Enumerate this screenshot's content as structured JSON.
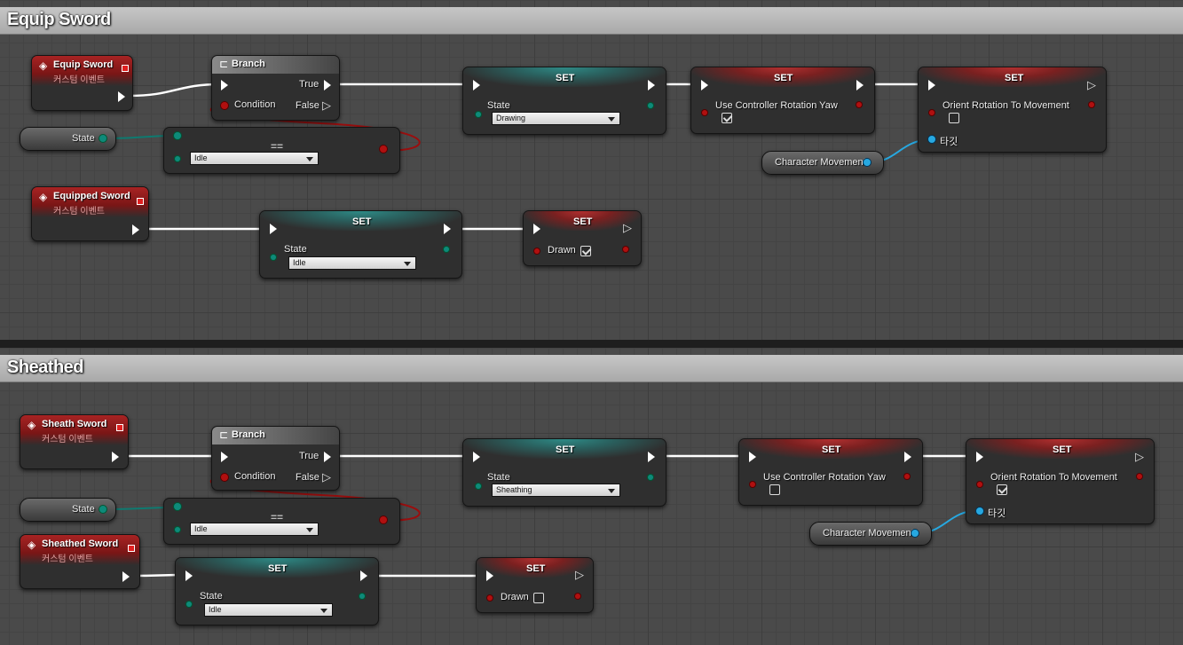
{
  "sections": [
    {
      "comment": "Equip Sword",
      "event": {
        "title": "Equip Sword",
        "subtitle": "커스텀 이벤트"
      },
      "branch": {
        "title": "Branch",
        "condition": "Condition",
        "true_label": "True",
        "false_label": "False"
      },
      "state_var": "State",
      "equals": {
        "symbol": "==",
        "value": "Idle"
      },
      "set_state": {
        "title": "SET",
        "pin_label": "State",
        "value": "Drawing"
      },
      "set_yaw": {
        "title": "SET",
        "pin_label": "Use Controller Rotation Yaw",
        "checked": true
      },
      "set_orient": {
        "title": "SET",
        "pin_label": "Orient Rotation To Movement",
        "target": "타깃",
        "checked": false
      },
      "char_movement": "Character Movement",
      "event2": {
        "title": "Equipped Sword",
        "subtitle": "커스텀 이벤트"
      },
      "set_state2": {
        "title": "SET",
        "pin_label": "State",
        "value": "Idle"
      },
      "set_drawn": {
        "title": "SET",
        "pin_label": "Drawn",
        "checked": true
      }
    },
    {
      "comment": "Sheathed",
      "event": {
        "title": "Sheath Sword",
        "subtitle": "커스텀 이벤트"
      },
      "branch": {
        "title": "Branch",
        "condition": "Condition",
        "true_label": "True",
        "false_label": "False"
      },
      "state_var": "State",
      "equals": {
        "symbol": "==",
        "value": "Idle"
      },
      "set_state": {
        "title": "SET",
        "pin_label": "State",
        "value": "Sheathing"
      },
      "set_yaw": {
        "title": "SET",
        "pin_label": "Use Controller Rotation Yaw",
        "checked": false
      },
      "set_orient": {
        "title": "SET",
        "pin_label": "Orient Rotation To Movement",
        "target": "타깃",
        "checked": true
      },
      "char_movement": "Character Movement",
      "event2": {
        "title": "Sheathed Sword",
        "subtitle": "커스텀 이벤트"
      },
      "set_state2": {
        "title": "SET",
        "pin_label": "State",
        "value": "Idle"
      },
      "set_drawn": {
        "title": "SET",
        "pin_label": "Drawn",
        "checked": false
      }
    }
  ],
  "colors": {
    "exec": "#ffffff",
    "bool_pin": "#b01010",
    "enum_pin": "#0e8a7a",
    "object_pin": "#27a8e0"
  }
}
